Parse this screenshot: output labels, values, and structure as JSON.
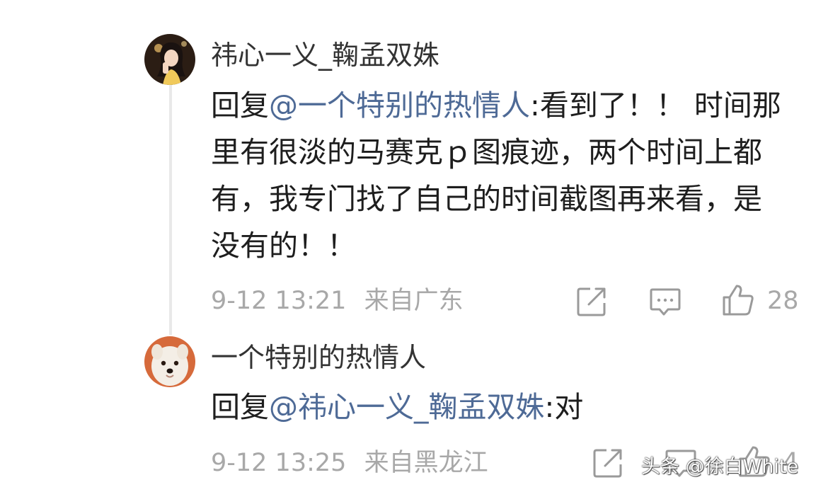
{
  "comments": [
    {
      "username": "祎心一义_鞠孟双姝",
      "reply_prefix": "回复",
      "mention": "@一个特别的热情人",
      "text_line1": ":看到了！！ 时间",
      "text_rest": "那里有很淡的马赛克ｐ图痕迹，两个时间上都有，我专门找了自己的时间截图再来看，是没有的！！",
      "date": "9-12 13:21",
      "location": "来自广东",
      "like_count": "28"
    },
    {
      "username": "一个特别的热情人",
      "reply_prefix": "回复",
      "mention": "@祎心一义_鞠孟双姝",
      "text": ":对",
      "date": "9-12 13:25",
      "location": "来自黑龙江",
      "like_count": "4"
    }
  ],
  "watermark": "头条 @徐白White",
  "colors": {
    "mention": "#4e6a96",
    "meta": "#a8a8a8",
    "text": "#1e1e1e",
    "thread_line": "#e9e9e9"
  },
  "icons": [
    "share-icon",
    "comment-icon",
    "like-icon"
  ]
}
